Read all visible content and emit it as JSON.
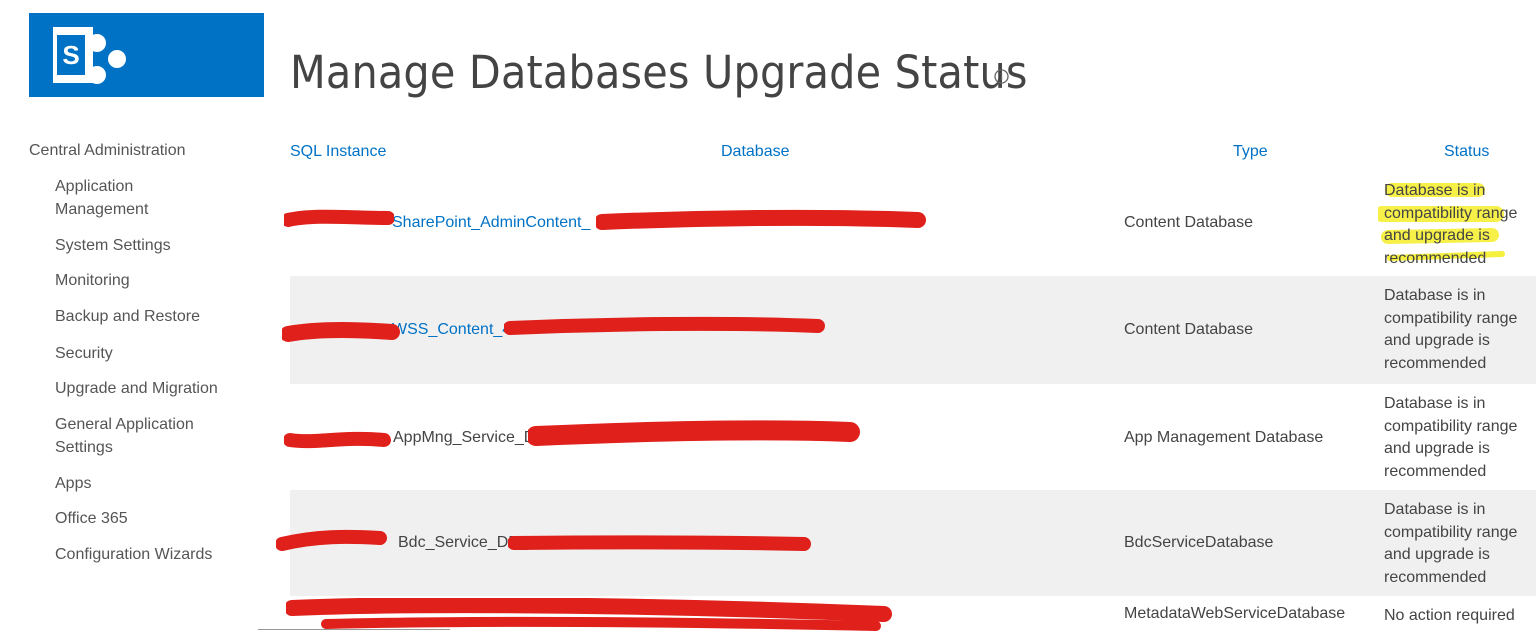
{
  "app": {
    "title": "Manage Databases Upgrade Status",
    "brand_color": "#0072c6",
    "logo_letter": "S"
  },
  "nav": {
    "root": "Central Administration",
    "items": [
      {
        "label": "Application Management"
      },
      {
        "label": "System Settings"
      },
      {
        "label": "Monitoring"
      },
      {
        "label": "Backup and Restore"
      },
      {
        "label": "Security"
      },
      {
        "label": "Upgrade and Migration"
      },
      {
        "label": "General Application Settings"
      },
      {
        "label": "Apps"
      },
      {
        "label": "Office 365"
      },
      {
        "label": "Configuration Wizards"
      }
    ]
  },
  "table": {
    "headers": {
      "sql_instance": "SQL Instance",
      "database": "Database",
      "type": "Type",
      "status": "Status"
    },
    "rows": [
      {
        "database": "SharePoint_AdminContent_",
        "type": "Content Database",
        "status": "Database is in compatibility range and upgrade is recommended",
        "highlighted": true,
        "link": true
      },
      {
        "database": "WSS_Content_4",
        "type": "Content Database",
        "status": "Database is in compatibility range and upgrade is recommended",
        "link": true
      },
      {
        "database": "AppMng_Service_DB",
        "type": "App Management Database",
        "status": "Database is in compatibility range and upgrade is recommended",
        "link": false
      },
      {
        "database": "Bdc_Service_DB_",
        "type": "BdcServiceDatabase",
        "status": "Database is in compatibility range and upgrade is recommended",
        "link": false
      },
      {
        "database": "",
        "type": "MetadataWebServiceDatabase",
        "status": "No action required",
        "link": false
      }
    ]
  },
  "colors": {
    "redaction": "#e0201b",
    "highlight": "#f5ee2a",
    "row_band": "#f0f0f0",
    "link": "#0072c6"
  }
}
